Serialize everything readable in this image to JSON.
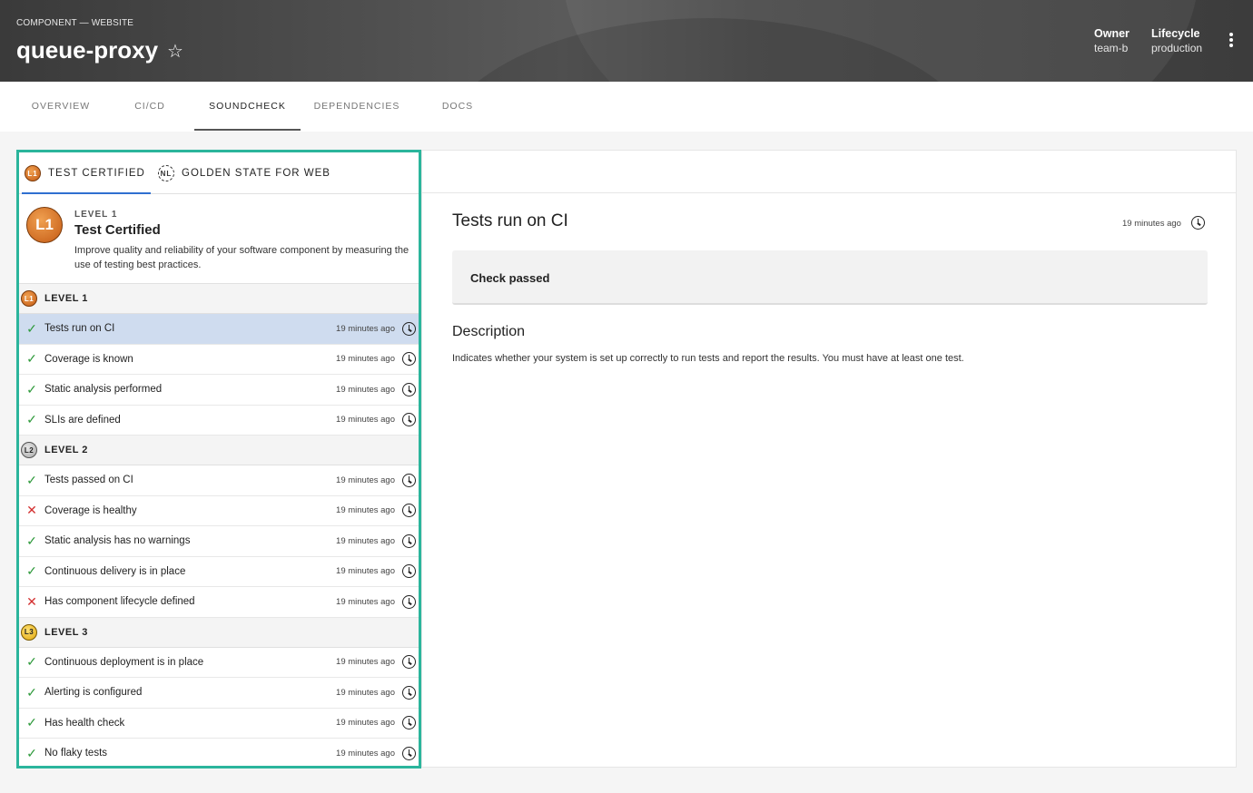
{
  "header": {
    "breadcrumb": "COMPONENT — WEBSITE",
    "title": "queue-proxy",
    "star_icon": "star-outline-icon",
    "owner_label": "Owner",
    "owner_value": "team-b",
    "lifecycle_label": "Lifecycle",
    "lifecycle_value": "production",
    "menu_icon": "kebab-menu-icon"
  },
  "tabs": [
    {
      "label": "OVERVIEW"
    },
    {
      "label": "CI/CD"
    },
    {
      "label": "SOUNDCHECK",
      "active": true
    },
    {
      "label": "DEPENDENCIES"
    },
    {
      "label": "DOCS"
    }
  ],
  "track_tabs": [
    {
      "badge": "L1",
      "label": "TEST CERTIFIED",
      "active": true
    },
    {
      "badge": "NL",
      "label": "GOLDEN STATE FOR WEB"
    }
  ],
  "level_header": {
    "badge": "L1",
    "kicker": "LEVEL 1",
    "name": "Test Certified",
    "description": "Improve quality and reliability of your software component by measuring the use of testing best practices."
  },
  "groups": [
    {
      "badge": "L2",
      "label": "LEVEL 2"
    },
    {
      "badge": "L3",
      "label": "LEVEL 3"
    }
  ],
  "level1_label": "LEVEL 1",
  "checks": [
    {
      "label": "Tests run on CI",
      "status": "pass",
      "time": "19 minutes ago",
      "selected": true
    },
    {
      "label": "Coverage is known",
      "status": "pass",
      "time": "19 minutes ago"
    },
    {
      "label": "Static analysis performed",
      "status": "pass",
      "time": "19 minutes ago"
    },
    {
      "label": "SLIs are defined",
      "status": "pass",
      "time": "19 minutes ago"
    },
    {
      "label": "Tests passed on CI",
      "status": "pass",
      "time": "19 minutes ago"
    },
    {
      "label": "Coverage is healthy",
      "status": "fail",
      "time": "19 minutes ago"
    },
    {
      "label": "Static analysis has no warnings",
      "status": "pass",
      "time": "19 minutes ago"
    },
    {
      "label": "Continuous delivery is in place",
      "status": "pass",
      "time": "19 minutes ago"
    },
    {
      "label": "Has component lifecycle defined",
      "status": "fail",
      "time": "19 minutes ago"
    },
    {
      "label": "Continuous deployment is in place",
      "status": "pass",
      "time": "19 minutes ago"
    },
    {
      "label": "Alerting is configured",
      "status": "pass",
      "time": "19 minutes ago"
    },
    {
      "label": "Has health check",
      "status": "pass",
      "time": "19 minutes ago"
    },
    {
      "label": "No flaky tests",
      "status": "pass",
      "time": "19 minutes ago"
    }
  ],
  "detail": {
    "title": "Tests run on CI",
    "time": "19 minutes ago",
    "status": "Check passed",
    "description_heading": "Description",
    "description": "Indicates whether your system is set up correctly to run tests and report the results. You must have at least one test."
  },
  "colors": {
    "accent_border": "#2bb59c",
    "selected_row": "#cfdcef",
    "pass": "#2e9a3b",
    "fail": "#d32f2f",
    "tab_indicator": "#2f6fd0"
  }
}
